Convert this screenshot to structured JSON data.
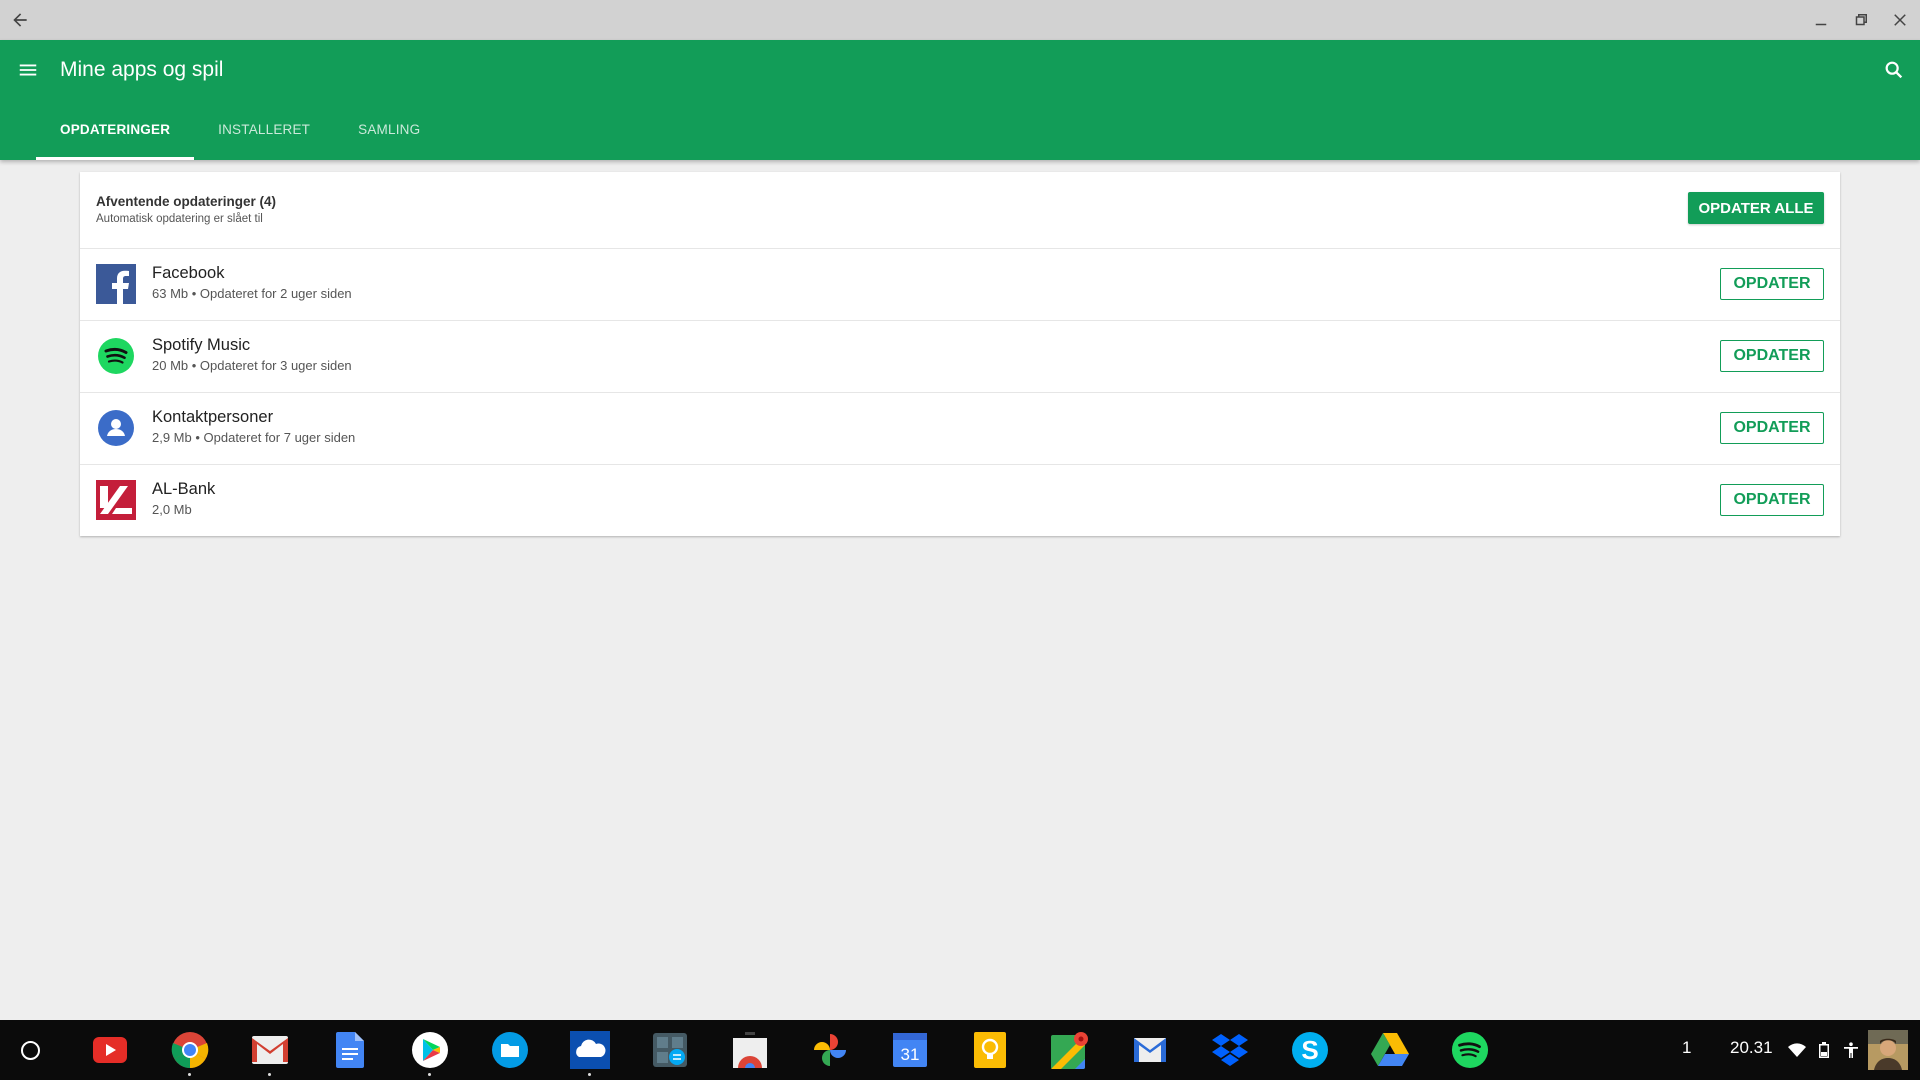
{
  "window": {
    "controls": [
      "back",
      "minimize",
      "restore",
      "close"
    ]
  },
  "appbar": {
    "title": "Mine apps og spil",
    "color": "#129d58",
    "tabs": [
      {
        "label": "OPDATERINGER",
        "active": true
      },
      {
        "label": "INSTALLERET",
        "active": false
      },
      {
        "label": "SAMLING",
        "active": false
      }
    ]
  },
  "updates": {
    "header_title": "Afventende opdateringer (4)",
    "header_subtitle": "Automatisk opdatering er slået til",
    "update_all_label": "OPDATER ALLE",
    "apps": [
      {
        "name": "Facebook",
        "meta": "63 Mb • Opdateret for 2 uger siden",
        "button": "OPDATER",
        "icon": "facebook-icon"
      },
      {
        "name": "Spotify Music",
        "meta": "20 Mb • Opdateret for 3 uger siden",
        "button": "OPDATER",
        "icon": "spotify-icon"
      },
      {
        "name": "Kontaktpersoner",
        "meta": "2,9 Mb • Opdateret for 7 uger siden",
        "button": "OPDATER",
        "icon": "contacts-icon"
      },
      {
        "name": "AL-Bank",
        "meta": "2,0 Mb",
        "button": "OPDATER",
        "icon": "al-bank-icon"
      }
    ]
  },
  "shelf": {
    "apps": [
      "youtube",
      "chrome",
      "gmail",
      "docs",
      "play-store",
      "files",
      "onedrive",
      "calculator",
      "web-store",
      "photos",
      "calendar",
      "keep",
      "maps",
      "inbox",
      "dropbox",
      "skype",
      "drive",
      "spotify"
    ],
    "calendar_day": "31",
    "notification_count": "1",
    "time": "20.31"
  }
}
